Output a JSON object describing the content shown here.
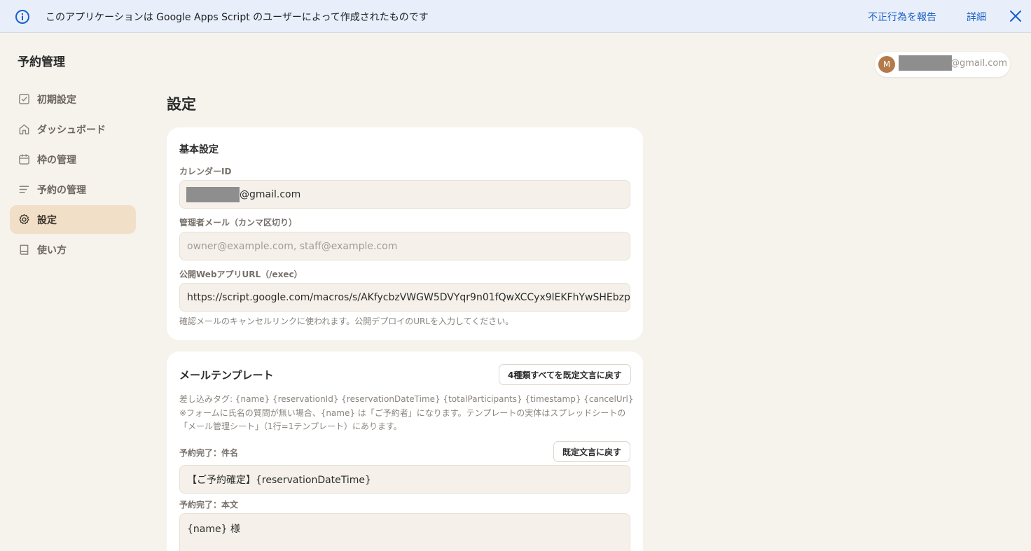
{
  "banner": {
    "message": "このアプリケーションは Google Apps Script のユーザーによって作成されたものです",
    "report_link": "不正行為を報告",
    "details_link": "詳細",
    "icon": "info-icon",
    "close_icon": "close-icon"
  },
  "app": {
    "title": "予約管理"
  },
  "account": {
    "avatar_letter": "M",
    "email_suffix": "@gmail.com"
  },
  "sidebar": {
    "items": [
      {
        "label": "初期設定",
        "icon": "checkbox-icon",
        "active": false
      },
      {
        "label": "ダッシュボード",
        "icon": "home-icon",
        "active": false
      },
      {
        "label": "枠の管理",
        "icon": "calendar-icon",
        "active": false
      },
      {
        "label": "予約の管理",
        "icon": "list-icon",
        "active": false
      },
      {
        "label": "設定",
        "icon": "gear-icon",
        "active": true
      },
      {
        "label": "使い方",
        "icon": "book-icon",
        "active": false
      }
    ]
  },
  "main": {
    "title": "設定",
    "basic": {
      "title": "基本設定",
      "calendar_label": "カレンダーID",
      "calendar_suffix": "@gmail.com",
      "admin_label": "管理者メール（カンマ区切り）",
      "admin_value": "",
      "admin_placeholder": "owner@example.com, staff@example.com",
      "webapp_label": "公開WebアプリURL（/exec）",
      "webapp_value": "https://script.google.com/macros/s/AKfycbzVWGW5DVYqr9n01fQwXCCyx9lEKFhYwSHEbzp",
      "webapp_help": "確認メールのキャンセルリンクに使われます。公開デプロイのURLを入力してください。"
    },
    "mail": {
      "title": "メールテンプレート",
      "reset_all_button": "4種類すべてを既定文言に戻す",
      "tags_line": "差し込みタグ: {name} {reservationId} {reservationDateTime} {totalParticipants} {timestamp} {cancelUrl}",
      "note_line1": "※フォームに氏名の質問が無い場合、{name} は「ご予約者」になります。テンプレートの実体はスプレッドシートの",
      "note_line2": "「メール管理シート」（1行=1テンプレート）にあります。",
      "subject_label": "予約完了：件名",
      "reset_button": "既定文言に戻す",
      "subject_value": "【ご予約確定】{reservationDateTime}",
      "body_label": "予約完了：本文",
      "body_value": "{name} 様"
    }
  }
}
